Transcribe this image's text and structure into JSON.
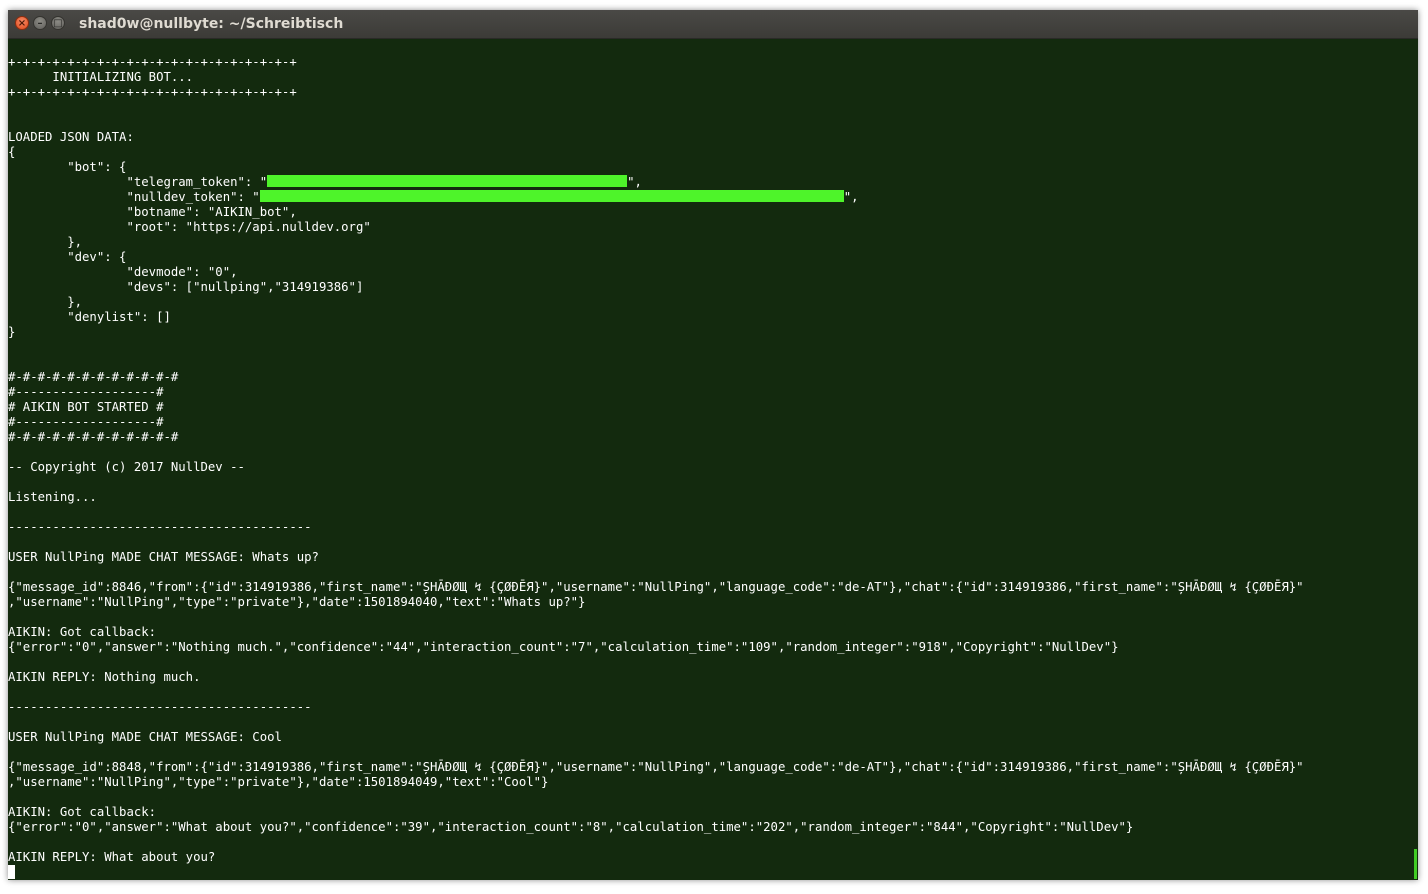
{
  "window": {
    "title": "shad0w@nullbyte: ~/Schreibtisch",
    "close_glyph": "×",
    "minimize_glyph": "–",
    "maximize_glyph": "□"
  },
  "terminal": {
    "lines": [
      "+-+-+-+-+-+-+-+-+-+-+-+-+-+-+-+-+-+-+-+",
      "      INITIALIZING BOT...",
      "+-+-+-+-+-+-+-+-+-+-+-+-+-+-+-+-+-+-+-+",
      "",
      "",
      "LOADED JSON DATA:",
      "{",
      "        \"bot\": {",
      "                \"telegram_token\": \"",
      "                \"nulldev_token\": \"",
      "                \"botname\": \"AIKIN_bot\",",
      "                \"root\": \"https://api.nulldev.org\"",
      "        },",
      "        \"dev\": {",
      "                \"devmode\": \"0\",",
      "                \"devs\": [\"nullping\",\"314919386\"]",
      "        },",
      "        \"denylist\": []",
      "}",
      "",
      "",
      "#-#-#-#-#-#-#-#-#-#-#-#",
      "#-------------------#",
      "# AIKIN BOT STARTED #",
      "#-------------------#",
      "#-#-#-#-#-#-#-#-#-#-#-#",
      "",
      "-- Copyright (c) 2017 NullDev --",
      "",
      "Listening...",
      "",
      "-----------------------------------------",
      "",
      "USER NullPing MADE CHAT MESSAGE: Whats up?",
      "",
      "{\"message_id\":8846,\"from\":{\"id\":314919386,\"first_name\":\"ȘHĀĐØЩ ↯ {ÇØĐĒЯ}\",\"username\":\"NullPing\",\"language_code\":\"de-AT\"},\"chat\":{\"id\":314919386,\"first_name\":\"ȘHĀĐØЩ ↯ {ÇØĐĒЯ}\"",
      ",\"username\":\"NullPing\",\"type\":\"private\"},\"date\":1501894040,\"text\":\"Whats up?\"}",
      "",
      "AIKIN: Got callback:",
      "{\"error\":\"0\",\"answer\":\"Nothing much.\",\"confidence\":\"44\",\"interaction_count\":\"7\",\"calculation_time\":\"109\",\"random_integer\":\"918\",\"Copyright\":\"NullDev\"}",
      "",
      "AIKIN REPLY: Nothing much.",
      "",
      "-----------------------------------------",
      "",
      "USER NullPing MADE CHAT MESSAGE: Cool",
      "",
      "{\"message_id\":8848,\"from\":{\"id\":314919386,\"first_name\":\"ȘHĀĐØЩ ↯ {ÇØĐĒЯ}\",\"username\":\"NullPing\",\"language_code\":\"de-AT\"},\"chat\":{\"id\":314919386,\"first_name\":\"ȘHĀĐØЩ ↯ {ÇØĐĒЯ}\"",
      ",\"username\":\"NullPing\",\"type\":\"private\"},\"date\":1501894049,\"text\":\"Cool\"}",
      "",
      "AIKIN: Got callback:",
      "{\"error\":\"0\",\"answer\":\"What about you?\",\"confidence\":\"39\",\"interaction_count\":\"8\",\"calculation_time\":\"202\",\"random_integer\":\"844\",\"Copyright\":\"NullDev\"}",
      "",
      "AIKIN REPLY: What about you?"
    ],
    "token_suffix_telegram": "\",",
    "token_suffix_nulldev": "\",",
    "redaction_color": "#4ef42a",
    "background_color": "#132a0e"
  }
}
